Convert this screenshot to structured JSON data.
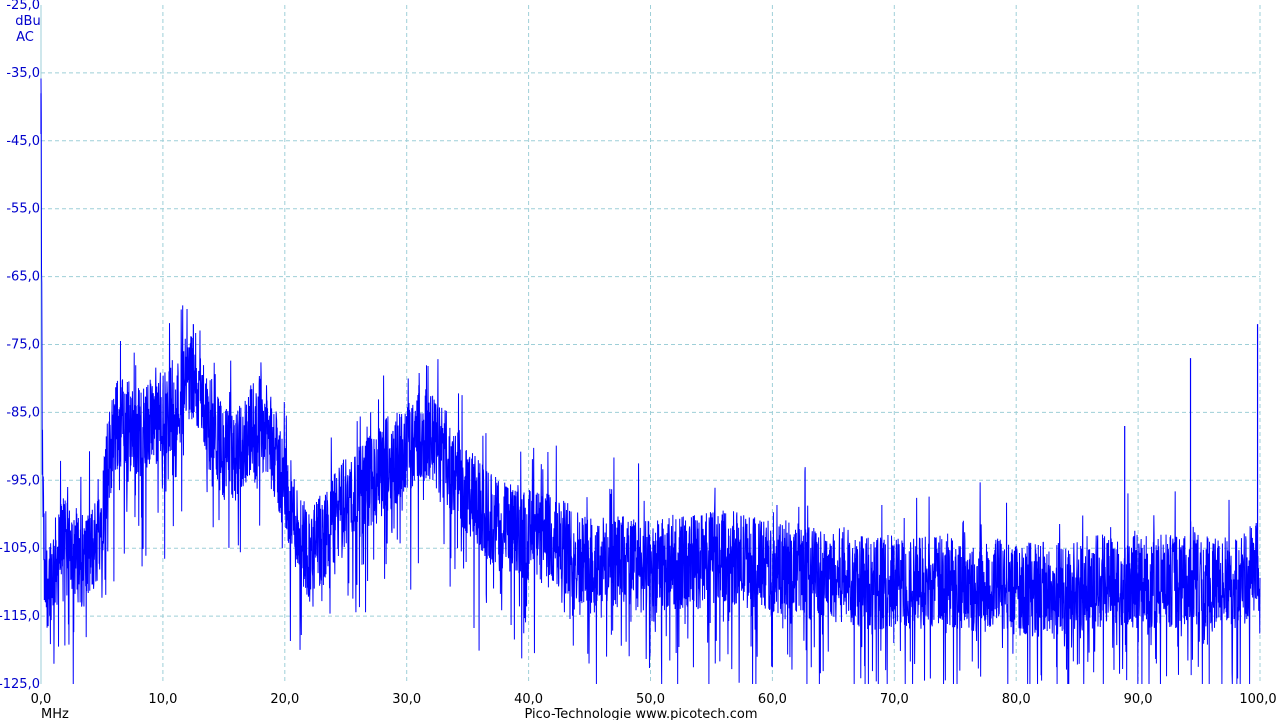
{
  "chart_data": {
    "type": "line",
    "title": "",
    "xlabel": "MHz",
    "ylabel_unit": "dBu",
    "ylabel_coupling": "AC",
    "xlim": [
      0,
      100
    ],
    "ylim": [
      -125,
      -25
    ],
    "x_ticks": [
      "0,0",
      "10,0",
      "20,0",
      "30,0",
      "40,0",
      "50,0",
      "60,0",
      "70,0",
      "80,0",
      "90,0",
      "100,0"
    ],
    "y_ticks": [
      "-25,0",
      "-35,0",
      "-45,0",
      "-55,0",
      "-65,0",
      "-75,0",
      "-85,0",
      "-95,0",
      "-105,0",
      "-115,0",
      "-125,0"
    ],
    "grid": true,
    "colors": {
      "trace": "#0000ff",
      "grid": "#9ecfd8",
      "axis_text": "#0000cc"
    },
    "series": [
      {
        "x": [
          0.0,
          0.1,
          0.3,
          0.5,
          1.0,
          1.5,
          2.0,
          2.5,
          3.0,
          3.5,
          4.0,
          4.5,
          5.0,
          5.5,
          6.0,
          6.5,
          7.0,
          7.5,
          8.0,
          9.0,
          10.0,
          11.0,
          12.0,
          12.5,
          13.0,
          14.0,
          15.0,
          16.0,
          17.0,
          18.0,
          19.0,
          20.0,
          21.0,
          22.0,
          23.0,
          24.0,
          25.0,
          26.0,
          27.0,
          28.0,
          29.0,
          30.0,
          31.0,
          32.0,
          33.0,
          34.0,
          35.0,
          36.0,
          37.0,
          38.0,
          40.0,
          42.0,
          44.0,
          46.0,
          48.0,
          50.0,
          52.0,
          54.0,
          56.0,
          58.0,
          60.0,
          62.0,
          64.0,
          66.0,
          68.0,
          70.0,
          72.0,
          74.0,
          76.0,
          78.0,
          80.0,
          82.0,
          84.0,
          86.0,
          88.0,
          90.0,
          91.0,
          92.0,
          93.0,
          94.0,
          94.3,
          95.0,
          96.0,
          97.0,
          98.0,
          99.0,
          99.5,
          99.8,
          100.0
        ],
        "y": [
          -38,
          -90,
          -112,
          -110,
          -108,
          -106,
          -102,
          -104,
          -106,
          -107,
          -106,
          -104,
          -100,
          -92,
          -88,
          -86,
          -87,
          -87,
          -88,
          -87,
          -86,
          -85,
          -80,
          -79,
          -82,
          -87,
          -91,
          -92,
          -88,
          -86,
          -90,
          -96,
          -102,
          -106,
          -104,
          -101,
          -98,
          -97,
          -95,
          -93,
          -92,
          -90,
          -88,
          -89,
          -91,
          -94,
          -97,
          -99,
          -101,
          -102,
          -103,
          -104,
          -106,
          -107,
          -107,
          -108,
          -107,
          -107,
          -106,
          -107,
          -108,
          -108,
          -109,
          -109,
          -110,
          -110,
          -110,
          -110,
          -110,
          -110,
          -111,
          -111,
          -111,
          -110,
          -110,
          -110,
          -110,
          -110,
          -110,
          -110,
          -108,
          -110,
          -110,
          -110,
          -110,
          -109,
          -108,
          -106,
          -112
        ]
      }
    ]
  },
  "footer": {
    "brand": "Pico-Technologie   www.picotech.com"
  }
}
